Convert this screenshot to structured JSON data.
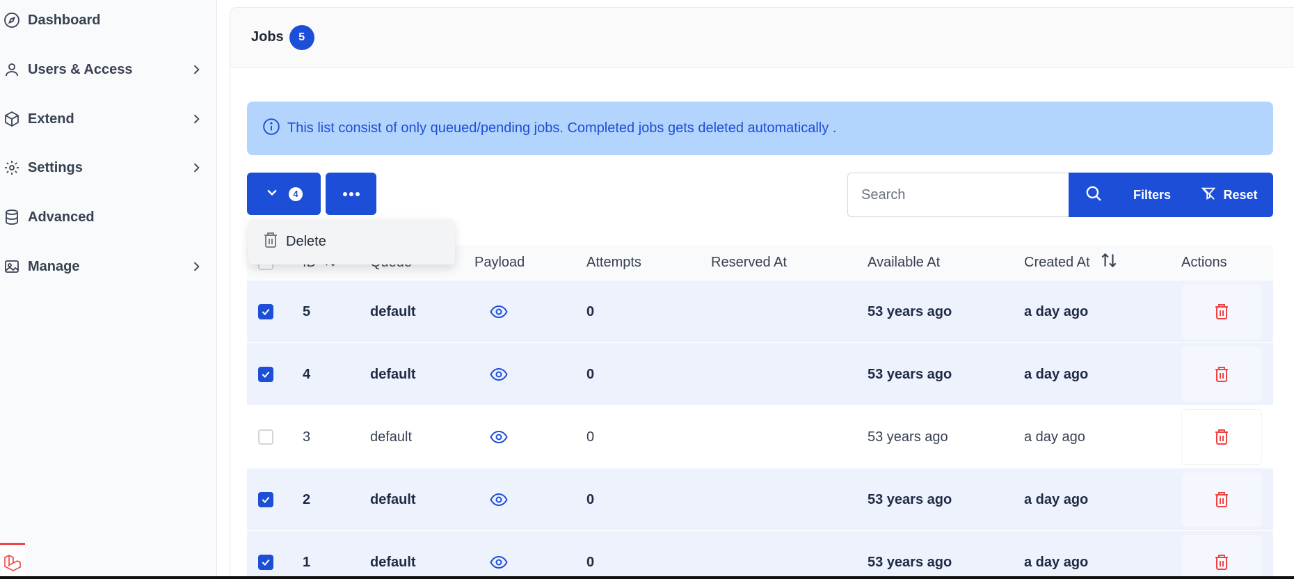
{
  "sidebar": {
    "items": [
      {
        "label": "Dashboard",
        "icon": "compass-icon",
        "has_chevron": false
      },
      {
        "label": "Users & Access",
        "icon": "user-icon",
        "has_chevron": true
      },
      {
        "label": "Extend",
        "icon": "cube-icon",
        "has_chevron": true
      },
      {
        "label": "Settings",
        "icon": "gear-icon",
        "has_chevron": true
      },
      {
        "label": "Advanced",
        "icon": "database-icon",
        "has_chevron": false
      },
      {
        "label": "Manage",
        "icon": "image-icon",
        "has_chevron": true
      }
    ]
  },
  "header": {
    "title": "Jobs",
    "count": "5"
  },
  "alert": {
    "text": "This list consist of only queued/pending jobs. Completed jobs gets deleted automatically ."
  },
  "toolbar": {
    "bulk_count": "4",
    "search_placeholder": "Search",
    "filters_label": "Filters",
    "reset_label": "Reset"
  },
  "bulk_menu": {
    "delete_label": "Delete"
  },
  "table": {
    "columns": [
      "ID",
      "Queue",
      "Payload",
      "Attempts",
      "Reserved At",
      "Available At",
      "Created At",
      "Actions"
    ],
    "rows": [
      {
        "id": "5",
        "queue": "default",
        "attempts": "0",
        "reserved_at": "",
        "available_at": "53 years ago",
        "created_at": "a day ago",
        "selected": true
      },
      {
        "id": "4",
        "queue": "default",
        "attempts": "0",
        "reserved_at": "",
        "available_at": "53 years ago",
        "created_at": "a day ago",
        "selected": true
      },
      {
        "id": "3",
        "queue": "default",
        "attempts": "0",
        "reserved_at": "",
        "available_at": "53 years ago",
        "created_at": "a day ago",
        "selected": false
      },
      {
        "id": "2",
        "queue": "default",
        "attempts": "0",
        "reserved_at": "",
        "available_at": "53 years ago",
        "created_at": "a day ago",
        "selected": true
      },
      {
        "id": "1",
        "queue": "default",
        "attempts": "0",
        "reserved_at": "",
        "available_at": "53 years ago",
        "created_at": "a day ago",
        "selected": true
      }
    ]
  },
  "colors": {
    "primary": "#1d4ed8",
    "danger": "#ef4444",
    "alert_bg": "#b3d4fc",
    "selected_row": "#eef2fd"
  }
}
